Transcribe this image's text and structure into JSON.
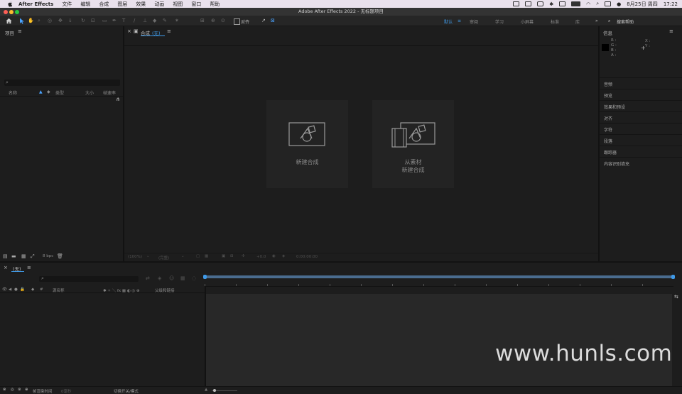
{
  "menubar": {
    "app": "After Effects",
    "items": [
      "文件",
      "编辑",
      "合成",
      "图层",
      "效果",
      "动画",
      "视图",
      "窗口",
      "帮助"
    ],
    "datetime": "8月25日 周四",
    "time": "17:22"
  },
  "window_title": "Adobe After Effects 2022 - 无标题项目",
  "toolbar": {
    "align_label": "对齐",
    "workspaces": [
      "默认",
      "审阅",
      "学习",
      "小屏幕",
      "标准",
      "库"
    ],
    "active_workspace": "默认",
    "search_placeholder": "搜索帮助"
  },
  "project_panel": {
    "title": "项目",
    "columns": [
      "名称",
      "类型",
      "大小",
      "帧速率"
    ],
    "bpc": "8 bpc"
  },
  "comp_panel": {
    "title": "合成",
    "tab": "(无)",
    "new_comp": "新建合成",
    "from_footage_line1": "从素材",
    "from_footage_line2": "新建合成",
    "footer": {
      "zoom": "(100%)",
      "resolution": "(完整)",
      "exposure": "+0.0",
      "timecode": "0:00:00:00"
    }
  },
  "info_panel": {
    "title": "信息",
    "rgba": [
      "R :",
      "G :",
      "B :",
      "A :"
    ],
    "xy": [
      "X :",
      "Y :"
    ]
  },
  "right_panels": [
    "音频",
    "预览",
    "效果和预设",
    "对齐",
    "字符",
    "段落",
    "跟踪器",
    "内容识别填充"
  ],
  "timeline": {
    "tab": "(无)",
    "source_name": "源名称",
    "parent": "父级和链接",
    "render_time": "帧渲染时间",
    "render_value": "0毫秒",
    "toggle": "切换开关/模式"
  },
  "watermark": "www.hunls.com",
  "colors": {
    "accent": "#3f9ae8",
    "menubar_bg": "#e9e1ec",
    "panel_bg": "#1d1d1d"
  }
}
